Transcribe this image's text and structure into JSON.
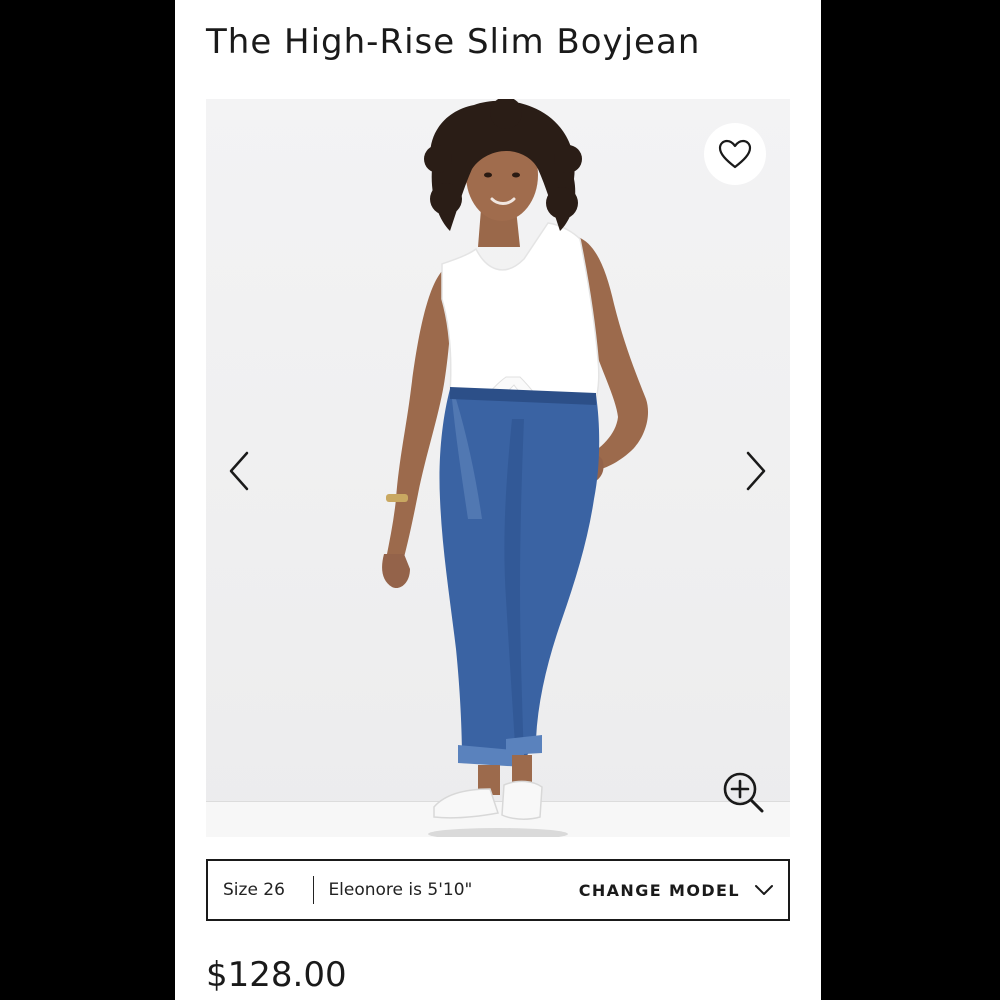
{
  "product": {
    "title": "The High-Rise Slim Boyjean",
    "price": "$128.00"
  },
  "gallery": {
    "favorite_icon": "heart-outline-icon",
    "prev_icon": "chevron-left-icon",
    "next_icon": "chevron-right-icon",
    "zoom_icon": "zoom-in-icon"
  },
  "model_info": {
    "size": "Size 26",
    "model": "Eleonore is 5'10\"",
    "change_label": "CHANGE MODEL",
    "change_icon": "chevron-down-icon"
  },
  "colors": {
    "text": "#1a1a1a",
    "image_bg": "#f0f0f1",
    "denim": "#3a63a3",
    "page_bg": "#000000"
  }
}
